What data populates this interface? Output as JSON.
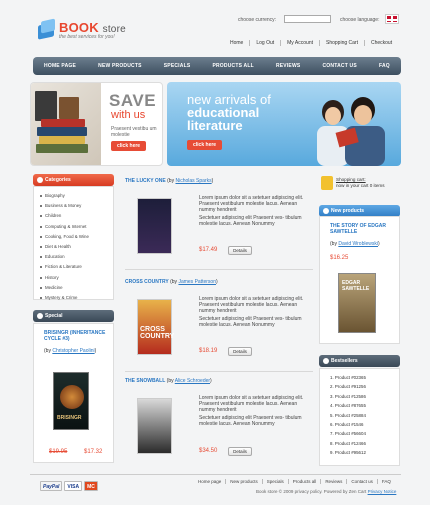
{
  "header": {
    "logo_title": "BOOK",
    "logo_title_suffix": "store",
    "tagline": "the best services for you!",
    "currency_label": "choose currency:",
    "language_label": "choose language:",
    "toplinks": [
      "Home",
      "Log Out",
      "My Account",
      "Shopping Cart",
      "Checkout"
    ]
  },
  "nav": [
    "HOME PAGE",
    "NEW PRODUCTS",
    "SPECIALS",
    "PRODUCTS ALL",
    "REVIEWS",
    "CONTACT US",
    "FAQ"
  ],
  "banner_left": {
    "headline": "SAVE",
    "subhead": "with us",
    "text": "Praesent vestibu um molestie",
    "button": "click here"
  },
  "banner_right": {
    "line1": "new arrivals of",
    "line2": "educational",
    "line3": "literature",
    "button": "click here"
  },
  "categories": {
    "title": "Categories",
    "items": [
      "Biography",
      "Business & Money",
      "Children",
      "Computing & Internet",
      "Cooking, Food & Wine",
      "Diet & Health",
      "Education",
      "Fiction & Literature",
      "History",
      "Medicine",
      "Mystery & Crime"
    ]
  },
  "special": {
    "title": "Special",
    "book_title": "BRISINGR (INHERITANCE CYCLE #3)",
    "by": "(by",
    "author": "Christopher Paolini",
    "by_close": ")",
    "old_price": "$19.95",
    "price": "$17.32"
  },
  "products": [
    {
      "title": "THE LUCKY ONE",
      "by": "(by",
      "author": "Nicholas Sparks",
      "close": ")",
      "text1": "Lorem ipsum dolor sit a setetuer adipiscing elit. Praesent vestibulum molestie lacus. Aenean nummy hendrerit",
      "text2": "Sectetuer adipiscing elit Praesent ves- tibulum molestie lacus. Aenean Nonummy",
      "price": "$17.49",
      "details": "Details"
    },
    {
      "title": "CROSS COUNTRY",
      "by": "(by",
      "author": "James Patterson",
      "close": ")",
      "text1": "Lorem ipsum dolor sit a setetuer adipiscing elit. Praesent vestibulum molestie lacus. Aenean nummy hendrerit",
      "text2": "Sectetuer adipiscing elit Praesent ves- tibulum molestie lacus. Aenean Nonummy",
      "price": "$18.19",
      "details": "Details"
    },
    {
      "title": "THE SNOWBALL",
      "by": "(by",
      "author": "Alice Schroeder",
      "close": ")",
      "text1": "Lorem ipsum dolor sit a setetuer adipiscing elit. Praesent vestibulum molestie lacus. Aenean nummy hendrerit",
      "text2": "Sectetuer adipiscing elit Praesent ves- tibulum molestie lacus. Aenean Nonummy",
      "price": "$34.50",
      "details": "Details"
    }
  ],
  "cart": {
    "title": "Shopping cart:",
    "text": "now in your cart 0 items"
  },
  "new_products": {
    "title": "New products",
    "book_title": "THE STORY OF EDGAR SAWTELLE",
    "by": "(by",
    "author": "David Wroblewski",
    "close": ")",
    "price": "$16.25"
  },
  "bestsellers": {
    "title": "Bestsellers",
    "items": [
      "1. Product #02365",
      "2. Product #91256",
      "3. Product #12586",
      "4. Product #87655",
      "5. Product #25884",
      "6. Product #1546",
      "7. Product #56604",
      "8. Product #12466",
      "9. Product #95612"
    ]
  },
  "footer": {
    "links": [
      "Home page",
      "New products",
      "Specials",
      "Products all",
      "Reviews",
      "Contact us",
      "FAQ"
    ],
    "copyright": "Book store © 2009 privacy policy. Powered by Zen Cart",
    "privacy": "Privacy Notice",
    "pay": [
      "PayPal",
      "VISA",
      "MC"
    ]
  },
  "colors": {
    "accent_red": "#e74c36",
    "accent_blue": "#2a77c2",
    "nav_dark": "#3d4f60"
  }
}
